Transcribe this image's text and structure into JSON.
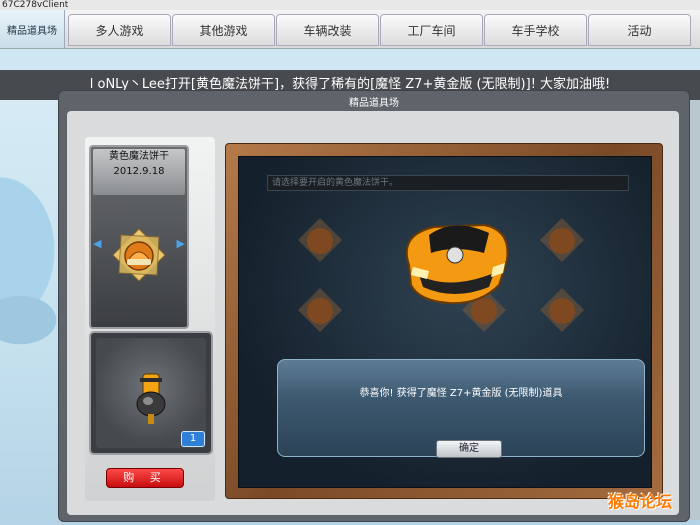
{
  "window": {
    "title": "67C278vClient"
  },
  "nav": {
    "active_label": "精品道具场",
    "tabs": [
      "多人游戏",
      "其他游戏",
      "车辆改装",
      "工厂车间",
      "车手学校",
      "活动"
    ]
  },
  "broadcast": {
    "text": "l oNLy丶Lee打开[黄色魔法饼干]，获得了稀有的[魔怪 Z7+黄金版 (无限制)]! 大家加油哦!"
  },
  "dialog": {
    "title": "精品道具场",
    "preview": {
      "name": "黄色魔法饼干",
      "date": "2012.9.18"
    },
    "item": {
      "count": "1"
    },
    "buy_label": "购 买",
    "hint_placeholder": "请选择要开启的黄色魔法饼干。",
    "result_message": "恭喜你! 获得了魔怪 Z7+黄金版 (无限制)道具",
    "ok_label": "确定"
  },
  "watermark": {
    "text": "猴岛论坛"
  },
  "colors": {
    "accent_red": "#d01414",
    "popup_blue": "#3d5970",
    "wood": "#8a552d"
  },
  "icons": [
    "left-arrow-icon",
    "right-arrow-icon",
    "cookie-icon",
    "pie-icon",
    "car-icon",
    "handle-icon"
  ]
}
